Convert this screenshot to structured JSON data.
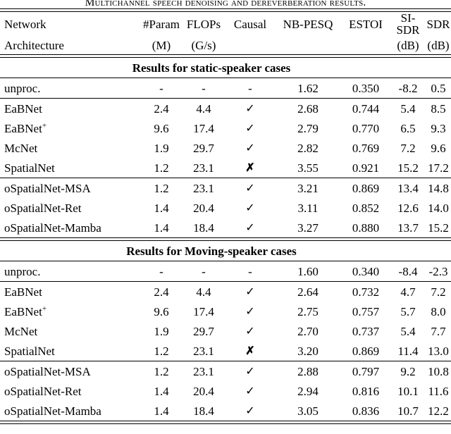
{
  "caption": "Multichannel speech denoising and dereverberation results.",
  "table": {
    "header_row_1": {
      "network": "Network",
      "columns": [
        "#Param",
        "FLOPs",
        "Causal",
        "NB-PESQ",
        "ESTOI",
        "SI-SDR",
        "SDR"
      ]
    },
    "header_row_2": {
      "network": "Architecture",
      "columns": [
        "(M)",
        "(G/s)",
        "",
        "",
        "",
        "(dB)",
        "(dB)"
      ]
    },
    "sections": [
      {
        "title": "Results for static-speaker cases",
        "groups": [
          {
            "rows": [
              {
                "name": "unproc.",
                "name_sup": "",
                "param": "-",
                "flops": "-",
                "causal": "-",
                "causal_kind": "dash",
                "nb_pesq": "1.62",
                "estoi": "0.350",
                "si_sdr": "-8.2",
                "sdr": "0.5"
              }
            ]
          },
          {
            "rows": [
              {
                "name": "EaBNet",
                "name_sup": "",
                "param": "2.4",
                "flops": "4.4",
                "causal": "✓",
                "causal_kind": "check",
                "nb_pesq": "2.68",
                "estoi": "0.744",
                "si_sdr": "5.4",
                "sdr": "8.5"
              },
              {
                "name": "EaBNet",
                "name_sup": "+",
                "param": "9.6",
                "flops": "17.4",
                "causal": "✓",
                "causal_kind": "check",
                "nb_pesq": "2.79",
                "estoi": "0.770",
                "si_sdr": "6.5",
                "sdr": "9.3"
              },
              {
                "name": "McNet",
                "name_sup": "",
                "param": "1.9",
                "flops": "29.7",
                "causal": "✓",
                "causal_kind": "check",
                "nb_pesq": "2.82",
                "estoi": "0.769",
                "si_sdr": "7.2",
                "sdr": "9.6"
              },
              {
                "name": "SpatialNet",
                "name_sup": "",
                "param": "1.2",
                "flops": "23.1",
                "causal": "✗",
                "causal_kind": "cross",
                "nb_pesq": "3.55",
                "estoi": "0.921",
                "si_sdr": "15.2",
                "sdr": "17.2"
              }
            ]
          },
          {
            "rows": [
              {
                "name": "oSpatialNet-MSA",
                "name_sup": "",
                "param": "1.2",
                "flops": "23.1",
                "causal": "✓",
                "causal_kind": "check",
                "nb_pesq": "3.21",
                "estoi": "0.869",
                "si_sdr": "13.4",
                "sdr": "14.8"
              },
              {
                "name": "oSpatialNet-Ret",
                "name_sup": "",
                "param": "1.4",
                "flops": "20.4",
                "causal": "✓",
                "causal_kind": "check",
                "nb_pesq": "3.11",
                "estoi": "0.852",
                "si_sdr": "12.6",
                "sdr": "14.0"
              },
              {
                "name": "oSpatialNet-Mamba",
                "name_sup": "",
                "param": "1.4",
                "flops": "18.4",
                "causal": "✓",
                "causal_kind": "check",
                "nb_pesq": "3.27",
                "estoi": "0.880",
                "si_sdr": "13.7",
                "sdr": "15.2"
              }
            ]
          }
        ]
      },
      {
        "title": "Results for Moving-speaker cases",
        "groups": [
          {
            "rows": [
              {
                "name": "unproc.",
                "name_sup": "",
                "param": "-",
                "flops": "-",
                "causal": "-",
                "causal_kind": "dash",
                "nb_pesq": "1.60",
                "estoi": "0.340",
                "si_sdr": "-8.4",
                "sdr": "-2.3"
              }
            ]
          },
          {
            "rows": [
              {
                "name": "EaBNet",
                "name_sup": "",
                "param": "2.4",
                "flops": "4.4",
                "causal": "✓",
                "causal_kind": "check",
                "nb_pesq": "2.64",
                "estoi": "0.732",
                "si_sdr": "4.7",
                "sdr": "7.2"
              },
              {
                "name": "EaBNet",
                "name_sup": "+",
                "param": "9.6",
                "flops": "17.4",
                "causal": "✓",
                "causal_kind": "check",
                "nb_pesq": "2.75",
                "estoi": "0.757",
                "si_sdr": "5.7",
                "sdr": "8.0"
              },
              {
                "name": "McNet",
                "name_sup": "",
                "param": "1.9",
                "flops": "29.7",
                "causal": "✓",
                "causal_kind": "check",
                "nb_pesq": "2.70",
                "estoi": "0.737",
                "si_sdr": "5.4",
                "sdr": "7.7"
              },
              {
                "name": "SpatialNet",
                "name_sup": "",
                "param": "1.2",
                "flops": "23.1",
                "causal": "✗",
                "causal_kind": "cross",
                "nb_pesq": "3.20",
                "estoi": "0.869",
                "si_sdr": "11.4",
                "sdr": "13.0"
              }
            ]
          },
          {
            "rows": [
              {
                "name": "oSpatialNet-MSA",
                "name_sup": "",
                "param": "1.2",
                "flops": "23.1",
                "causal": "✓",
                "causal_kind": "check",
                "nb_pesq": "2.88",
                "estoi": "0.797",
                "si_sdr": "9.2",
                "sdr": "10.8"
              },
              {
                "name": "oSpatialNet-Ret",
                "name_sup": "",
                "param": "1.4",
                "flops": "20.4",
                "causal": "✓",
                "causal_kind": "check",
                "nb_pesq": "2.94",
                "estoi": "0.816",
                "si_sdr": "10.1",
                "sdr": "11.6"
              },
              {
                "name": "oSpatialNet-Mamba",
                "name_sup": "",
                "param": "1.4",
                "flops": "18.4",
                "causal": "✓",
                "causal_kind": "check",
                "nb_pesq": "3.05",
                "estoi": "0.836",
                "si_sdr": "10.7",
                "sdr": "12.2"
              }
            ]
          }
        ]
      }
    ]
  }
}
